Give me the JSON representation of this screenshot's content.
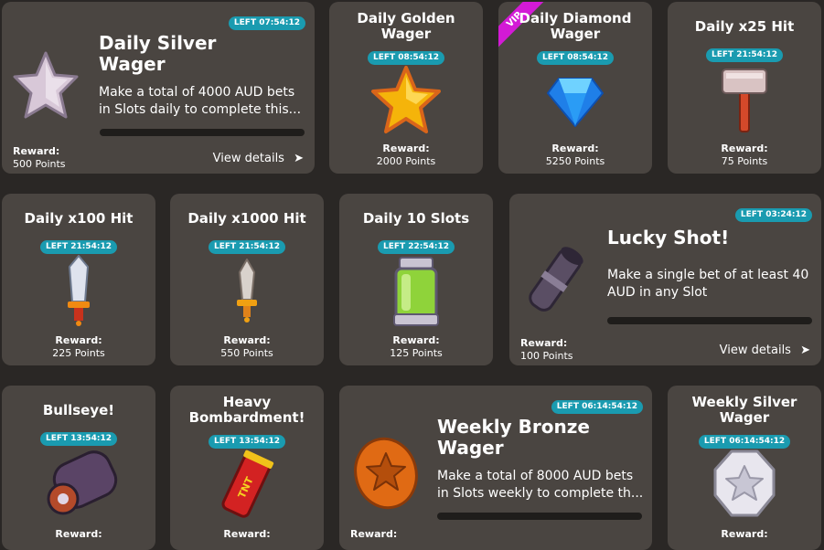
{
  "cards": [
    {
      "title": "Daily Silver\nWager",
      "timer": "LEFT 07:54:12",
      "desc": "Make a total of 4000 AUD bets in Slots daily to complete this...",
      "reward_label": "Reward:",
      "reward_value": "500 Points",
      "view": "View details",
      "arrow": "➤",
      "icon": "silver-star-icon"
    },
    {
      "title": "Daily Golden\nWager",
      "timer": "LEFT 08:54:12",
      "reward_label": "Reward:",
      "reward_value": "2000 Points",
      "icon": "golden-star-icon"
    },
    {
      "title": "Daily Diamond\nWager",
      "timer": "LEFT 08:54:12",
      "vip": "VIP",
      "reward_label": "Reward:",
      "reward_value": "5250 Points",
      "icon": "diamond-icon"
    },
    {
      "title": "Daily x25 Hit",
      "timer": "LEFT 21:54:12",
      "reward_label": "Reward:",
      "reward_value": "75 Points",
      "icon": "hammer-icon"
    },
    {
      "title": "Daily x100 Hit",
      "timer": "LEFT 21:54:12",
      "reward_label": "Reward:",
      "reward_value": "225 Points",
      "icon": "dagger-icon"
    },
    {
      "title": "Daily x1000 Hit",
      "timer": "LEFT 21:54:12",
      "reward_label": "Reward:",
      "reward_value": "550 Points",
      "icon": "dagger-icon"
    },
    {
      "title": "Daily 10 Slots",
      "timer": "LEFT 22:54:12",
      "reward_label": "Reward:",
      "reward_value": "125 Points",
      "icon": "potion-jar-icon"
    },
    {
      "title": "Lucky Shot!",
      "timer": "LEFT 03:24:12",
      "desc": "Make a single bet of at least 40 AUD in any Slot",
      "reward_label": "Reward:",
      "reward_value": "100 Points",
      "view": "View details",
      "arrow": "➤",
      "icon": "cannon-icon"
    },
    {
      "title": "Bullseye!",
      "timer": "LEFT 13:54:12",
      "reward_label": "Reward:",
      "icon": "cannon-icon"
    },
    {
      "title": "Heavy\nBombardment!",
      "timer": "LEFT 13:54:12",
      "reward_label": "Reward:",
      "icon": "tnt-dynamite-icon",
      "tnt": "TNT"
    },
    {
      "title": "Weekly Bronze\nWager",
      "timer": "LEFT 06:14:54:12",
      "desc": "Make a total of 8000 AUD bets in Slots weekly to complete th...",
      "reward_label": "Reward:",
      "icon": "bronze-star-coin-icon"
    },
    {
      "title": "Weekly Silver\nWager",
      "timer": "LEFT 06:14:54:12",
      "reward_label": "Reward:",
      "icon": "silver-star-coin-icon"
    }
  ]
}
